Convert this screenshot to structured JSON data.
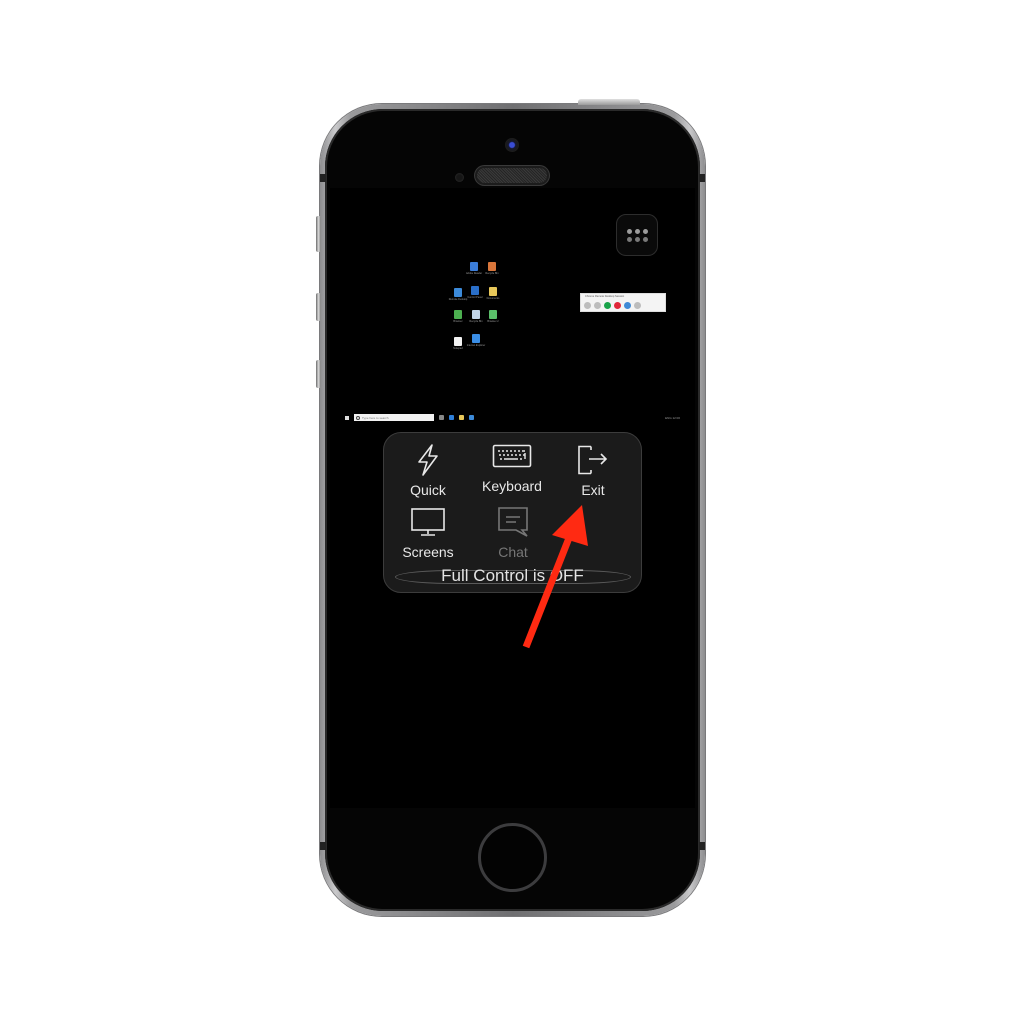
{
  "device": {
    "model": "iPhone SE style frame"
  },
  "remote_desktop": {
    "desktop_icons": [
      {
        "label": "Adobe Reader",
        "color": "#3b7dd8"
      },
      {
        "label": "Recycle Bin",
        "color": "#d9763b"
      },
      {
        "label": "Remote Desktop",
        "color": "#3c8ad9"
      },
      {
        "label": "Control Panel",
        "color": "#2a6fc9"
      },
      {
        "label": "Documents",
        "color": "#e8c85a"
      },
      {
        "label": "Browser",
        "color": "#4caf50"
      },
      {
        "label": "Recycle Bin",
        "color": "#c0d4e8"
      },
      {
        "label": "Browser 2",
        "color": "#5bbf6a"
      },
      {
        "label": "Notepad",
        "color": "#f2f2f2"
      },
      {
        "label": "Internet Explorer",
        "color": "#3a8ee6"
      }
    ],
    "remote_window": {
      "title": "Chrome Remote Desktop Session",
      "buttons": [
        {
          "name": "menu",
          "color": "#bdbdbd"
        },
        {
          "name": "screens",
          "color": "#bdbdbd"
        },
        {
          "name": "accept",
          "color": "#1aa34a"
        },
        {
          "name": "stop",
          "color": "#e0283a"
        },
        {
          "name": "chat",
          "color": "#3f8ad6"
        },
        {
          "name": "file",
          "color": "#bdbdbd"
        }
      ]
    },
    "taskbar": {
      "search_placeholder": "Type here to search",
      "tray_text": "ENG 12:00"
    }
  },
  "menu_button": {
    "label": "More options"
  },
  "control_panel": {
    "tools": [
      {
        "id": "quick",
        "label": "Quick",
        "icon": "lightning-icon",
        "enabled": true
      },
      {
        "id": "keyboard",
        "label": "Keyboard",
        "icon": "keyboard-icon",
        "enabled": true
      },
      {
        "id": "exit",
        "label": "Exit",
        "icon": "exit-icon",
        "enabled": true
      },
      {
        "id": "screens",
        "label": "Screens",
        "icon": "monitor-icon",
        "enabled": true
      },
      {
        "id": "chat",
        "label": "Chat",
        "icon": "chat-icon",
        "enabled": false
      }
    ],
    "full_control_status": "Full Control is OFF"
  },
  "annotation": {
    "type": "arrow",
    "target": "Exit",
    "color": "#ff2a12"
  }
}
